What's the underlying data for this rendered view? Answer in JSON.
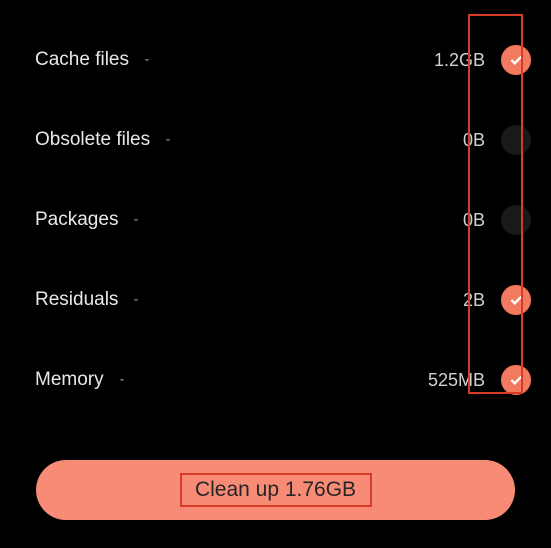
{
  "items": [
    {
      "label": "Cache files",
      "size": "1.2GB",
      "checked": true
    },
    {
      "label": "Obsolete files",
      "size": "0B",
      "checked": false
    },
    {
      "label": "Packages",
      "size": "0B",
      "checked": false
    },
    {
      "label": "Residuals",
      "size": "2B",
      "checked": true
    },
    {
      "label": "Memory",
      "size": "525MB",
      "checked": true
    }
  ],
  "clean_button_label": "Clean up 1.76GB"
}
